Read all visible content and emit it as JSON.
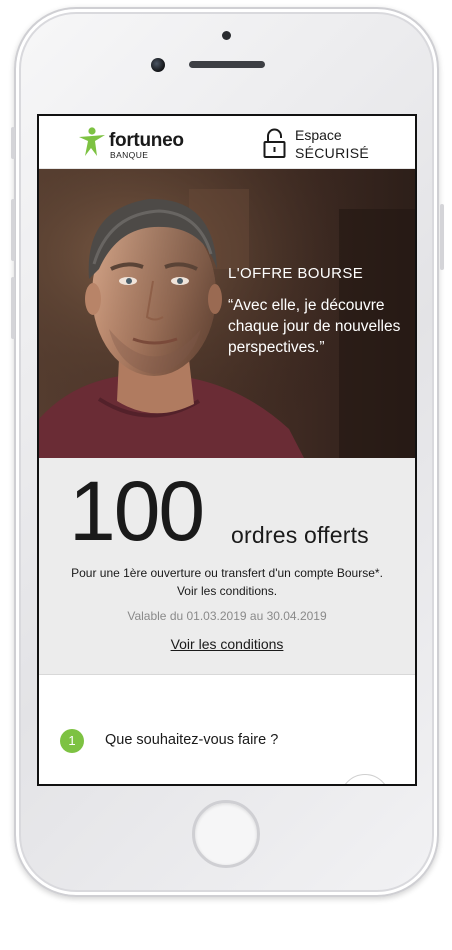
{
  "header": {
    "brand_name": "fortuneo",
    "brand_sub": "BANQUE",
    "secure_line1": "Espace",
    "secure_line2": "SÉCURISÉ"
  },
  "hero": {
    "kicker": "L'OFFRE BOURSE",
    "quote": "“Avec elle, je découvre chaque jour de nouvelles perspectives.”"
  },
  "offer": {
    "number": "100",
    "unit": "ordres offerts",
    "description_line1": "Pour une 1ère ouverture ou transfert d'un compte Bourse*.",
    "description_line2": "Voir les conditions.",
    "validity": "Valable du 01.03.2019 au 30.04.2019",
    "link_label": "Voir les conditions"
  },
  "step": {
    "number": "1",
    "question": "Que souhaitez-vous faire ?"
  },
  "icons": {
    "logo": "fortuneo-logo-icon",
    "lock": "lock-icon"
  },
  "colors": {
    "brand_green": "#7dc242",
    "offer_background": "#ececec"
  }
}
